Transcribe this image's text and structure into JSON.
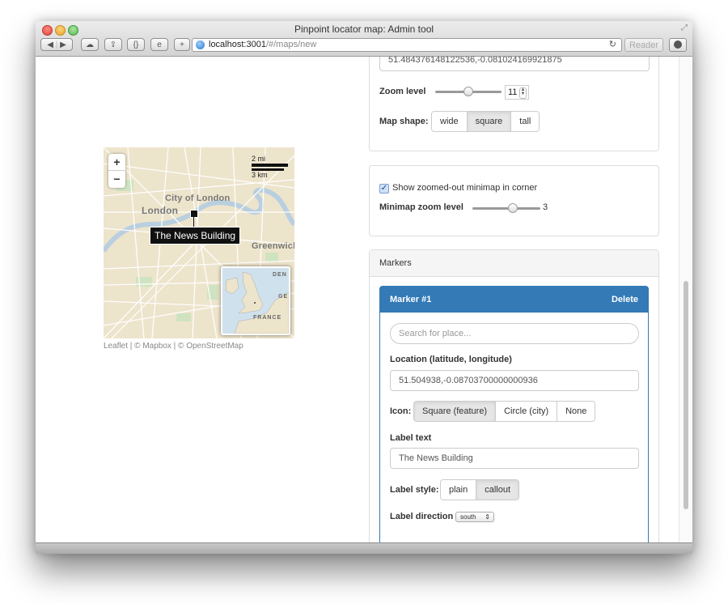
{
  "window": {
    "title": "Pinpoint locator map: Admin tool",
    "url_host": "localhost:3001",
    "url_path": "/#/maps/new",
    "reader_label": "Reader",
    "toolbar_icons": [
      "back-icon",
      "forward-icon",
      "icloud-icon",
      "share-icon",
      "braces-icon",
      "ie-icon",
      "new-tab-icon"
    ]
  },
  "map": {
    "zoom_in": "+",
    "zoom_out": "−",
    "scale_miles": "2 mi",
    "scale_km": "3 km",
    "places": [
      "City of London",
      "London",
      "Greenwich"
    ],
    "marker_label": "The News Building",
    "minimap_labels": [
      "DEN",
      "GE",
      "FRANCE"
    ],
    "attribution": "Leaflet | © Mapbox | © OpenStreetMap"
  },
  "settings": {
    "center_value": "51.484376148122536,-0.081024169921875",
    "zoom_label": "Zoom level",
    "zoom_value": "11",
    "zoom_fraction": 0.5,
    "shape_label": "Map shape:",
    "shapes": [
      {
        "label": "wide",
        "active": false
      },
      {
        "label": "square",
        "active": true
      },
      {
        "label": "tall",
        "active": false
      }
    ]
  },
  "minimap": {
    "checkbox_label": "Show zoomed-out minimap in corner",
    "checked": true,
    "zoom_label": "Minimap zoom level",
    "zoom_value": "3",
    "zoom_fraction": 0.6
  },
  "markers": {
    "heading": "Markers",
    "items": [
      {
        "title": "Marker #1",
        "delete_label": "Delete",
        "search_placeholder": "Search for place...",
        "location_label": "Location (latitude, longitude)",
        "location_value": "51.504938,-0.08703700000000936",
        "icon_label": "Icon:",
        "icons": [
          {
            "label": "Square (feature)",
            "active": true
          },
          {
            "label": "Circle (city)",
            "active": false
          },
          {
            "label": "None",
            "active": false
          }
        ],
        "label_text_label": "Label text",
        "label_text_value": "The News Building",
        "label_style_label": "Label style:",
        "label_styles": [
          {
            "label": "plain",
            "active": false
          },
          {
            "label": "callout",
            "active": true
          }
        ],
        "label_direction_label": "Label direction",
        "label_direction_value": "south"
      }
    ]
  },
  "colors": {
    "accent": "#337ab7",
    "map_land": "#ede4cc",
    "map_water": "#b9cfe0"
  }
}
